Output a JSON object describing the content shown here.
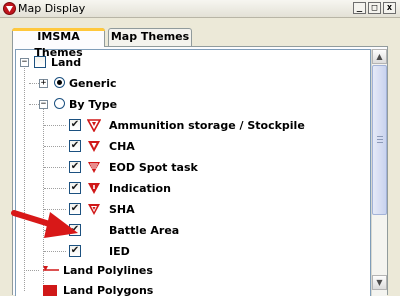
{
  "window": {
    "title": "Map Display",
    "controls": {
      "minimize": "_",
      "maximize": "□",
      "close": "x"
    }
  },
  "tabs": [
    {
      "label": "IMSMA Themes",
      "active": true
    },
    {
      "label": "Map Themes",
      "active": false
    }
  ],
  "tree": {
    "root": {
      "label": "Land",
      "expander": "−"
    },
    "generic": {
      "label": "Generic",
      "expander": "+",
      "selected": true
    },
    "by_type": {
      "label": "By Type",
      "expander": "−",
      "selected": false
    },
    "items": [
      {
        "label": "Ammunition storage / Stockpile",
        "checked": true,
        "icon": "ammunition-symbol"
      },
      {
        "label": "CHA",
        "checked": true,
        "icon": "cha-symbol"
      },
      {
        "label": "EOD Spot task",
        "checked": true,
        "icon": "eod-symbol"
      },
      {
        "label": "Indication",
        "checked": true,
        "icon": "indication-symbol"
      },
      {
        "label": "SHA",
        "checked": true,
        "icon": "sha-symbol"
      },
      {
        "label": "Battle Area",
        "checked": true,
        "icon": "none"
      },
      {
        "label": "IED",
        "checked": true,
        "icon": "none"
      }
    ],
    "polylines": {
      "label": "Land Polylines"
    },
    "polygons": {
      "label": "Land Polygons"
    }
  },
  "colors": {
    "symbol_red": "#d01818",
    "arrow_red": "#d81818"
  }
}
